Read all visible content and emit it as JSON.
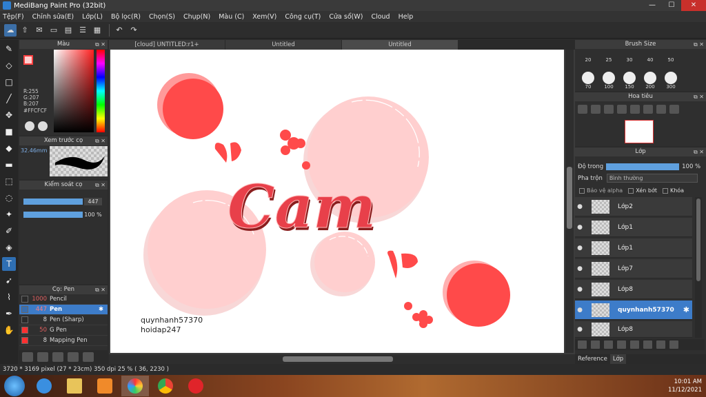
{
  "window": {
    "title": "MediBang Paint Pro (32bit)"
  },
  "menu": [
    "Tệp(F)",
    "Chỉnh sửa(E)",
    "Lớp(L)",
    "Bộ lọc(R)",
    "Chọn(S)",
    "Chụp(N)",
    "Màu (C)",
    "Xem(V)",
    "Công cụ(T)",
    "Cửa sổ(W)",
    "Cloud",
    "Help"
  ],
  "color_panel": {
    "title": "Màu",
    "r": "R:255",
    "g": "G:207",
    "b": "B:207",
    "hex": "#FFCFCF",
    "fg_color": "#ffcfcf"
  },
  "brush_preview": {
    "title": "Xem trước cọ",
    "size": "32.46mm"
  },
  "brush_control": {
    "title": "Kiểm soát cọ",
    "size_value": "447",
    "opacity_value": "100 %"
  },
  "brush_list": {
    "title": "Cọ: Pen",
    "items": [
      {
        "size": "1000",
        "name": "Pencil",
        "color": "#2a2a2a"
      },
      {
        "size": "447",
        "name": "Pen",
        "color": "#3a6fb0"
      },
      {
        "size": "8",
        "name": "Pen (Sharp)",
        "color": "#2a2a2a"
      },
      {
        "size": "50",
        "name": "G Pen",
        "color": "#ff3030"
      },
      {
        "size": "8",
        "name": "Mapping Pen",
        "color": "#ff3030"
      }
    ]
  },
  "tabs": [
    "[cloud] UNTITLED:r1+",
    "Untitled",
    "Untitled"
  ],
  "canvas": {
    "word": "Cam",
    "signature_line1": "quynhanh57370",
    "signature_line2": "hoidap247"
  },
  "brush_size_panel": {
    "title": "Brush Size",
    "row1": [
      "20",
      "25",
      "30",
      "40",
      "50"
    ],
    "row2": [
      "70",
      "100",
      "150",
      "200",
      "300"
    ]
  },
  "navigator": {
    "title": "Hoa tiêu"
  },
  "layer_panel": {
    "title": "Lớp",
    "opacity_label": "Độ trong",
    "opacity_value": "100 %",
    "blend_label": "Pha trộn",
    "blend_value": "Bình thường",
    "protect_alpha": "Bảo vệ alpha",
    "clipping": "Xén bớt",
    "lock": "Khóa",
    "layers": [
      "Lớp2",
      "Lớp1",
      "Lớp1",
      "Lớp7",
      "Lớp8",
      "quynhanh57370",
      "Lớp8"
    ]
  },
  "right_tabs": [
    "Reference",
    "Lớp"
  ],
  "status": "3720 * 3169 pixel   (27 * 23cm)   350 dpi   25 %   ( 36, 2230 )",
  "clock": {
    "time": "10:01 AM",
    "date": "11/12/2021"
  },
  "colors": {
    "accent": "#3d7cc9",
    "red": "#ff4a4a",
    "pink": "#ffcfcf"
  }
}
